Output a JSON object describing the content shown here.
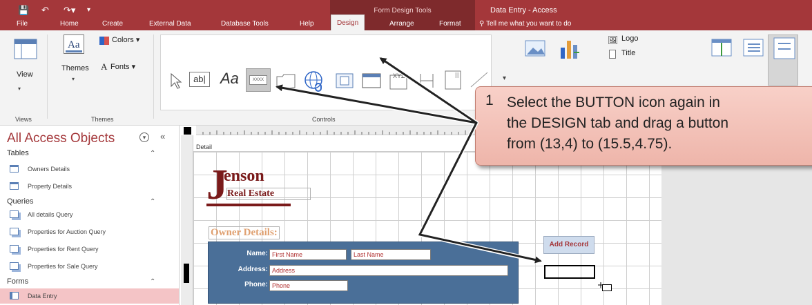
{
  "window": {
    "context_label": "Form Design Tools",
    "title": "Data Entry  -  Access"
  },
  "tabs": [
    {
      "label": "File"
    },
    {
      "label": "Home"
    },
    {
      "label": "Create"
    },
    {
      "label": "External Data"
    },
    {
      "label": "Database Tools"
    },
    {
      "label": "Help"
    },
    {
      "label": "Design"
    },
    {
      "label": "Arrange"
    },
    {
      "label": "Format"
    }
  ],
  "tell_me": "Tell me what you want to do",
  "ribbon": {
    "view_label": "View",
    "views_group": "Views",
    "themes_label": "Themes",
    "colors_label": "Colors",
    "fonts_label": "Fonts",
    "themes_group": "Themes",
    "controls_group": "Controls",
    "textbox_glyph": "ab|",
    "label_glyph": "Aa",
    "button_glyph": "XXXX",
    "logo_label": "Logo",
    "title_label": "Title"
  },
  "nav": {
    "title": "All Access Objects",
    "sections": {
      "tables": "Tables",
      "queries": "Queries",
      "forms": "Forms"
    },
    "tables": [
      "Owners Details",
      "Property Details"
    ],
    "queries": [
      "All details Query",
      "Properties for Auction Query",
      "Properties for Rent Query",
      "Properties for Sale Query"
    ],
    "forms": [
      "Data Entry"
    ]
  },
  "form": {
    "section": "Detail",
    "logo_big": "enson",
    "logo_initial": "J",
    "logo_small": "Real Estate",
    "heading": "Owner Details:",
    "name_label": "Name:",
    "first_name": "First Name",
    "last_name": "Last Name",
    "address_label": "Address:",
    "address": "Address",
    "phone_label": "Phone:",
    "phone": "Phone",
    "add_record": "Add Record"
  },
  "callout": {
    "number": "1",
    "line1": "Select the BUTTON icon again in",
    "line2": "the DESIGN tab and drag a button",
    "line3": "from (13,4) to (15.5,4.75)."
  }
}
